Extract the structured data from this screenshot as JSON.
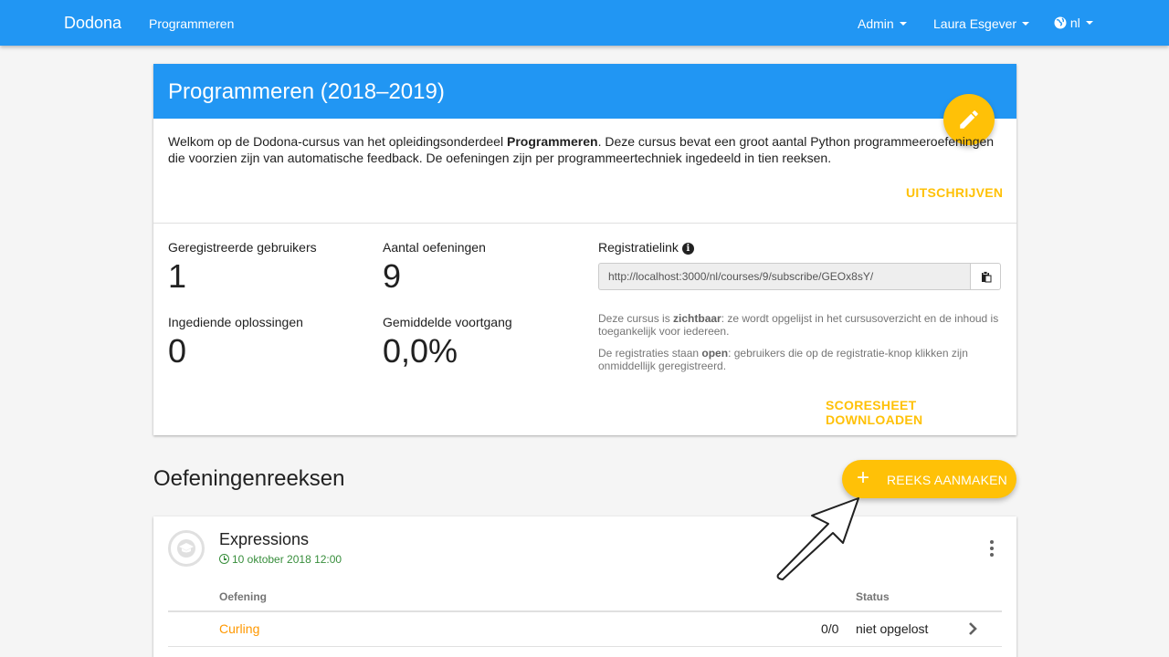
{
  "navbar": {
    "brand": "Dodona",
    "link_programmeren": "Programmeren",
    "menu_admin": "Admin",
    "menu_user": "Laura Esgever",
    "menu_language": "nl"
  },
  "course": {
    "title": "Programmeren (2018–2019)",
    "description_before": "Welkom op de Dodona-cursus van het opleidingsonderdeel ",
    "description_bold": "Programmeren",
    "description_after": ". Deze cursus bevat een groot aantal Python programmeeroefeningen die voorzien zijn van automatische feedback. De oefeningen zijn per programmeertechniek ingedeeld in tien reeksen.",
    "unsubscribe_label": "Uitschrijven",
    "stats": {
      "users_label": "Geregistreerde gebruikers",
      "users_value": "1",
      "exercises_label": "Aantal oefeningen",
      "exercises_value": "9",
      "submissions_label": "Ingediende oplossingen",
      "submissions_value": "0",
      "progress_label": "Gemiddelde voortgang",
      "progress_value": "0,0%"
    },
    "registration": {
      "label": "Registratielink",
      "link": "http://localhost:3000/nl/courses/9/subscribe/GEOx8sY/",
      "visibility_before": "Deze cursus is ",
      "visibility_bold": "zichtbaar",
      "visibility_after": ": ze wordt opgelijst in het cursusoverzicht en de inhoud is toegankelijk voor iedereen.",
      "registration_before": "De registraties staan ",
      "registration_bold": "open",
      "registration_after": ": gebruikers die op de registratie-knop klikken zijn onmiddellijk geregistreerd."
    },
    "scoresheet_label": "Scoresheet downloaden"
  },
  "series_section": {
    "title": "Oefeningenreeksen",
    "add_button_label": "REEKS AANMAKEN"
  },
  "series": {
    "title": "Expressions",
    "deadline": "10 oktober 2018 12:00",
    "table_headers": {
      "exercise": "Oefening",
      "status": "Status"
    },
    "rows": [
      {
        "name": "Curling",
        "score": "0/0",
        "status": "niet opgelost"
      }
    ]
  },
  "colors": {
    "primary": "#2196f3",
    "accent": "#ffc107",
    "link": "#ff9800",
    "deadline": "#388e3c"
  },
  "icons": [
    "pencil-icon",
    "info-icon",
    "clipboard-icon",
    "plus-icon",
    "mortarboard-icon",
    "clock-icon",
    "more-vert-icon",
    "chevron-right-icon",
    "globe-icon",
    "arrow-pointer-icon"
  ]
}
